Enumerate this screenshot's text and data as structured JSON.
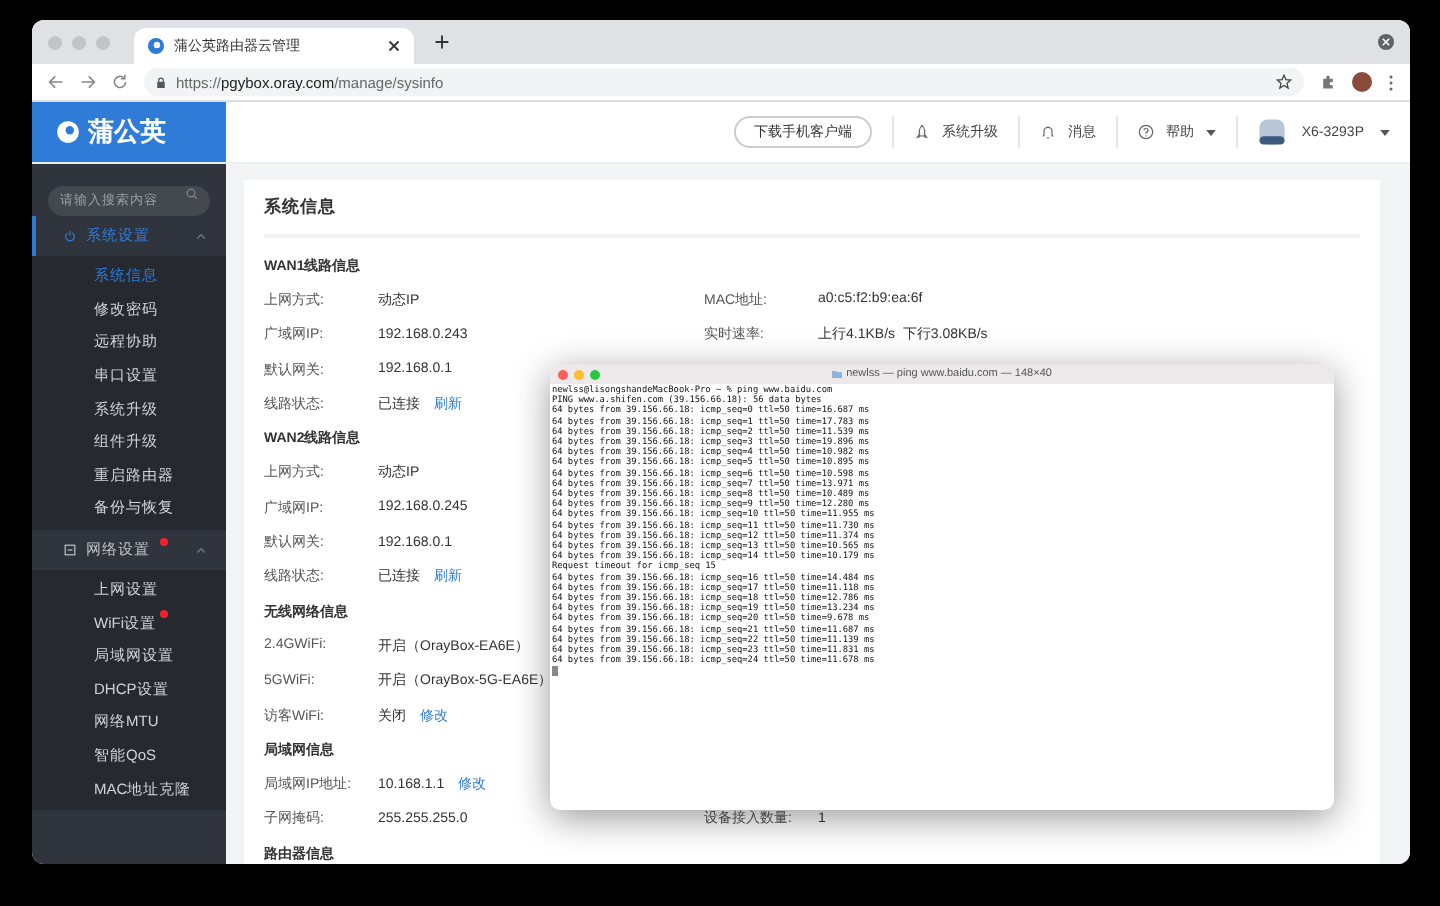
{
  "browser": {
    "tab_title": "蒲公英路由器云管理",
    "url": "https://**pgybox.oray.com**/manage/sysinfo"
  },
  "header": {
    "logo_text": "蒲公英",
    "download_button": "下载手机客户端",
    "actions": [
      {
        "kind": "upgrade",
        "label": "系统升级"
      },
      {
        "kind": "message",
        "label": "消息"
      },
      {
        "kind": "help",
        "label": "帮助"
      }
    ],
    "device_name": "X6-3293P"
  },
  "sidebar": {
    "search_placeholder": "请输入搜索内容",
    "groups": [
      {
        "kind": "system",
        "label": "系统设置",
        "selected": true,
        "expanded": true,
        "badge": false,
        "items": [
          {
            "label": "系统信息",
            "selected": true,
            "badge": false
          },
          {
            "label": "修改密码",
            "selected": false,
            "badge": false
          },
          {
            "label": "远程协助",
            "selected": false,
            "badge": false
          },
          {
            "label": "串口设置",
            "selected": false,
            "badge": false
          },
          {
            "label": "系统升级",
            "selected": false,
            "badge": false
          },
          {
            "label": "组件升级",
            "selected": false,
            "badge": false
          },
          {
            "label": "重启路由器",
            "selected": false,
            "badge": false
          },
          {
            "label": "备份与恢复",
            "selected": false,
            "badge": false
          }
        ]
      },
      {
        "kind": "network",
        "label": "网络设置",
        "selected": false,
        "expanded": true,
        "badge": true,
        "items": [
          {
            "label": "上网设置",
            "selected": false,
            "badge": false
          },
          {
            "label": "WiFi设置",
            "selected": false,
            "badge": true
          },
          {
            "label": "局域网设置",
            "selected": false,
            "badge": false
          },
          {
            "label": "DHCP设置",
            "selected": false,
            "badge": false
          },
          {
            "label": "网络MTU",
            "selected": false,
            "badge": false
          },
          {
            "label": "智能QoS",
            "selected": false,
            "badge": false
          },
          {
            "label": "MAC地址克隆",
            "selected": false,
            "badge": false
          }
        ]
      }
    ]
  },
  "content": {
    "title": "系统信息",
    "sections": [
      {
        "title": "WAN1线路信息",
        "rows": [
          {
            "left": {
              "label": "上网方式:",
              "value": "动态IP"
            },
            "right": {
              "label": "MAC地址:",
              "value": "a0:c5:f2:b9:ea:6f"
            }
          },
          {
            "left": {
              "label": "广域网IP:",
              "value": "192.168.0.243"
            },
            "right": {
              "label": "实时速率:",
              "value": "上行4.1KB/s  下行3.08KB/s"
            }
          },
          {
            "left": {
              "label": "默认网关:",
              "value": "192.168.0.1"
            }
          },
          {
            "left": {
              "label": "线路状态:",
              "value": "已连接",
              "link": "刷新"
            }
          }
        ]
      },
      {
        "title": "WAN2线路信息",
        "rows": [
          {
            "left": {
              "label": "上网方式:",
              "value": "动态IP"
            }
          },
          {
            "left": {
              "label": "广域网IP:",
              "value": "192.168.0.245"
            }
          },
          {
            "left": {
              "label": "默认网关:",
              "value": "192.168.0.1"
            }
          },
          {
            "left": {
              "label": "线路状态:",
              "value": "已连接",
              "link": "刷新"
            }
          }
        ]
      },
      {
        "title": "无线网络信息",
        "rows": [
          {
            "left": {
              "label": "2.4GWiFi:",
              "value": "开启（OrayBox-EA6E）"
            }
          },
          {
            "left": {
              "label": "5GWiFi:",
              "value": "开启（OrayBox-5G-EA6E）"
            }
          },
          {
            "left": {
              "label": "访客WiFi:",
              "value": "关闭",
              "link": "修改"
            }
          }
        ]
      },
      {
        "title": "局域网信息",
        "rows": [
          {
            "left": {
              "label": "局域网IP地址:",
              "value": "10.168.1.1",
              "link": "修改"
            }
          },
          {
            "left": {
              "label": "子网掩码:",
              "value": "255.255.255.0"
            },
            "right": {
              "label": "设备接入数量:",
              "value": "1"
            }
          }
        ]
      },
      {
        "title": "路由器信息"
      }
    ]
  },
  "terminal": {
    "title": "newlss — ping www.baidu.com — 148×40",
    "lines": [
      "newlss@lisongshandeMacBook-Pro ~ % ping www.baidu.com",
      "PING www.a.shifen.com (39.156.66.18): 56 data bytes",
      "64 bytes from 39.156.66.18: icmp_seq=0 ttl=50 time=16.687 ms",
      "64 bytes from 39.156.66.18: icmp_seq=1 ttl=50 time=17.783 ms",
      "64 bytes from 39.156.66.18: icmp_seq=2 ttl=50 time=11.539 ms",
      "64 bytes from 39.156.66.18: icmp_seq=3 ttl=50 time=19.896 ms",
      "64 bytes from 39.156.66.18: icmp_seq=4 ttl=50 time=10.982 ms",
      "64 bytes from 39.156.66.18: icmp_seq=5 ttl=50 time=10.895 ms",
      "64 bytes from 39.156.66.18: icmp_seq=6 ttl=50 time=10.598 ms",
      "64 bytes from 39.156.66.18: icmp_seq=7 ttl=50 time=13.971 ms",
      "64 bytes from 39.156.66.18: icmp_seq=8 ttl=50 time=10.489 ms",
      "64 bytes from 39.156.66.18: icmp_seq=9 ttl=50 time=12.280 ms",
      "64 bytes from 39.156.66.18: icmp_seq=10 ttl=50 time=11.955 ms",
      "64 bytes from 39.156.66.18: icmp_seq=11 ttl=50 time=11.730 ms",
      "64 bytes from 39.156.66.18: icmp_seq=12 ttl=50 time=11.374 ms",
      "64 bytes from 39.156.66.18: icmp_seq=13 ttl=50 time=10.565 ms",
      "64 bytes from 39.156.66.18: icmp_seq=14 ttl=50 time=10.179 ms",
      "Request timeout for icmp_seq 15",
      "64 bytes from 39.156.66.18: icmp_seq=16 ttl=50 time=14.484 ms",
      "64 bytes from 39.156.66.18: icmp_seq=17 ttl=50 time=11.118 ms",
      "64 bytes from 39.156.66.18: icmp_seq=18 ttl=50 time=12.786 ms",
      "64 bytes from 39.156.66.18: icmp_seq=19 ttl=50 time=13.234 ms",
      "64 bytes from 39.156.66.18: icmp_seq=20 ttl=50 time=9.678 ms",
      "64 bytes from 39.156.66.18: icmp_seq=21 ttl=50 time=11.687 ms",
      "64 bytes from 39.156.66.18: icmp_seq=22 ttl=50 time=11.139 ms",
      "64 bytes from 39.156.66.18: icmp_seq=23 ttl=50 time=11.831 ms",
      "64 bytes from 39.156.66.18: icmp_seq=24 ttl=50 time=11.678 ms"
    ]
  }
}
